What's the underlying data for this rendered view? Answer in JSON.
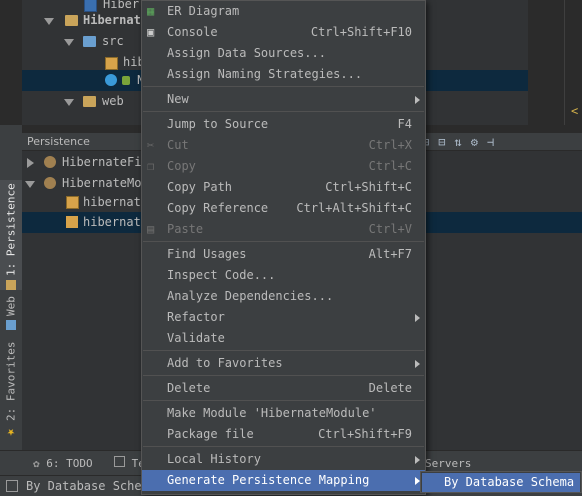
{
  "project_tree": {
    "items": [
      {
        "label": "Hiber",
        "kind": "file"
      },
      {
        "label": "Hibernate",
        "kind": "module"
      },
      {
        "label": "src",
        "kind": "folder"
      },
      {
        "label": "hib",
        "kind": "xml"
      },
      {
        "label": "N",
        "kind": "class"
      },
      {
        "label": "web",
        "kind": "folder"
      }
    ]
  },
  "persistence": {
    "title": "Persistence",
    "items": [
      {
        "label": "HibernateFi",
        "expanded": false
      },
      {
        "label": "HibernateMod",
        "expanded": true
      },
      {
        "label": "hibernate",
        "kind": "config"
      },
      {
        "label": "hibernate",
        "kind": "mapping"
      }
    ],
    "toolbar_icons": [
      "expand-all-icon",
      "collapse-all-icon",
      "sync-icon",
      "settings-icon",
      "hide-icon"
    ]
  },
  "side_tabs": [
    {
      "label": "1: Persistence"
    },
    {
      "label": "Web"
    },
    {
      "label": "2: Favorites"
    }
  ],
  "bottom_tabs": [
    {
      "label": "6: TODO"
    },
    {
      "label": "Te"
    },
    {
      "label": "Servers"
    }
  ],
  "status": {
    "text": "By Database Schema"
  },
  "context_menu": {
    "items": [
      {
        "label": "ER Diagram",
        "shortcut": "",
        "submenu": false,
        "disabled": false,
        "icon": "er-diagram-icon"
      },
      {
        "label": "Console",
        "shortcut": "Ctrl+Shift+F10",
        "submenu": false,
        "disabled": false,
        "icon": "console-icon"
      },
      {
        "label": "Assign Data Sources...",
        "shortcut": "",
        "submenu": false,
        "disabled": false
      },
      {
        "label": "Assign Naming Strategies...",
        "shortcut": "",
        "submenu": false,
        "disabled": false
      },
      {
        "separator": true
      },
      {
        "label": "New",
        "shortcut": "",
        "submenu": true,
        "disabled": false
      },
      {
        "separator": true
      },
      {
        "label": "Jump to Source",
        "shortcut": "F4",
        "submenu": false,
        "disabled": false
      },
      {
        "label": "Cut",
        "shortcut": "Ctrl+X",
        "submenu": false,
        "disabled": true,
        "icon": "cut-icon"
      },
      {
        "label": "Copy",
        "shortcut": "Ctrl+C",
        "submenu": false,
        "disabled": true,
        "icon": "copy-icon"
      },
      {
        "label": "Copy Path",
        "shortcut": "Ctrl+Shift+C",
        "submenu": false,
        "disabled": false
      },
      {
        "label": "Copy Reference",
        "shortcut": "Ctrl+Alt+Shift+C",
        "submenu": false,
        "disabled": false
      },
      {
        "label": "Paste",
        "shortcut": "Ctrl+V",
        "submenu": false,
        "disabled": true,
        "icon": "paste-icon"
      },
      {
        "separator": true
      },
      {
        "label": "Find Usages",
        "shortcut": "Alt+F7",
        "submenu": false,
        "disabled": false
      },
      {
        "label": "Inspect Code...",
        "shortcut": "",
        "submenu": false,
        "disabled": false
      },
      {
        "label": "Analyze Dependencies...",
        "shortcut": "",
        "submenu": false,
        "disabled": false
      },
      {
        "label": "Refactor",
        "shortcut": "",
        "submenu": true,
        "disabled": false
      },
      {
        "label": "Validate",
        "shortcut": "",
        "submenu": false,
        "disabled": false
      },
      {
        "separator": true
      },
      {
        "label": "Add to Favorites",
        "shortcut": "",
        "submenu": true,
        "disabled": false
      },
      {
        "separator": true
      },
      {
        "label": "Delete",
        "shortcut": "Delete",
        "submenu": false,
        "disabled": false
      },
      {
        "separator": true
      },
      {
        "label": "Make Module 'HibernateModule'",
        "shortcut": "",
        "submenu": false,
        "disabled": false
      },
      {
        "label": "Package file",
        "shortcut": "Ctrl+Shift+F9",
        "submenu": false,
        "disabled": false
      },
      {
        "separator": true
      },
      {
        "label": "Local History",
        "shortcut": "",
        "submenu": true,
        "disabled": false
      },
      {
        "label": "Generate Persistence Mapping",
        "shortcut": "",
        "submenu": true,
        "disabled": false,
        "highlighted": true
      }
    ]
  },
  "submenu": {
    "label": "By Database Schema"
  },
  "colors": {
    "highlight": "#4b6eaf",
    "menu_bg": "#3c3f41",
    "panel_bg": "#313335",
    "selection": "#0d293e"
  }
}
